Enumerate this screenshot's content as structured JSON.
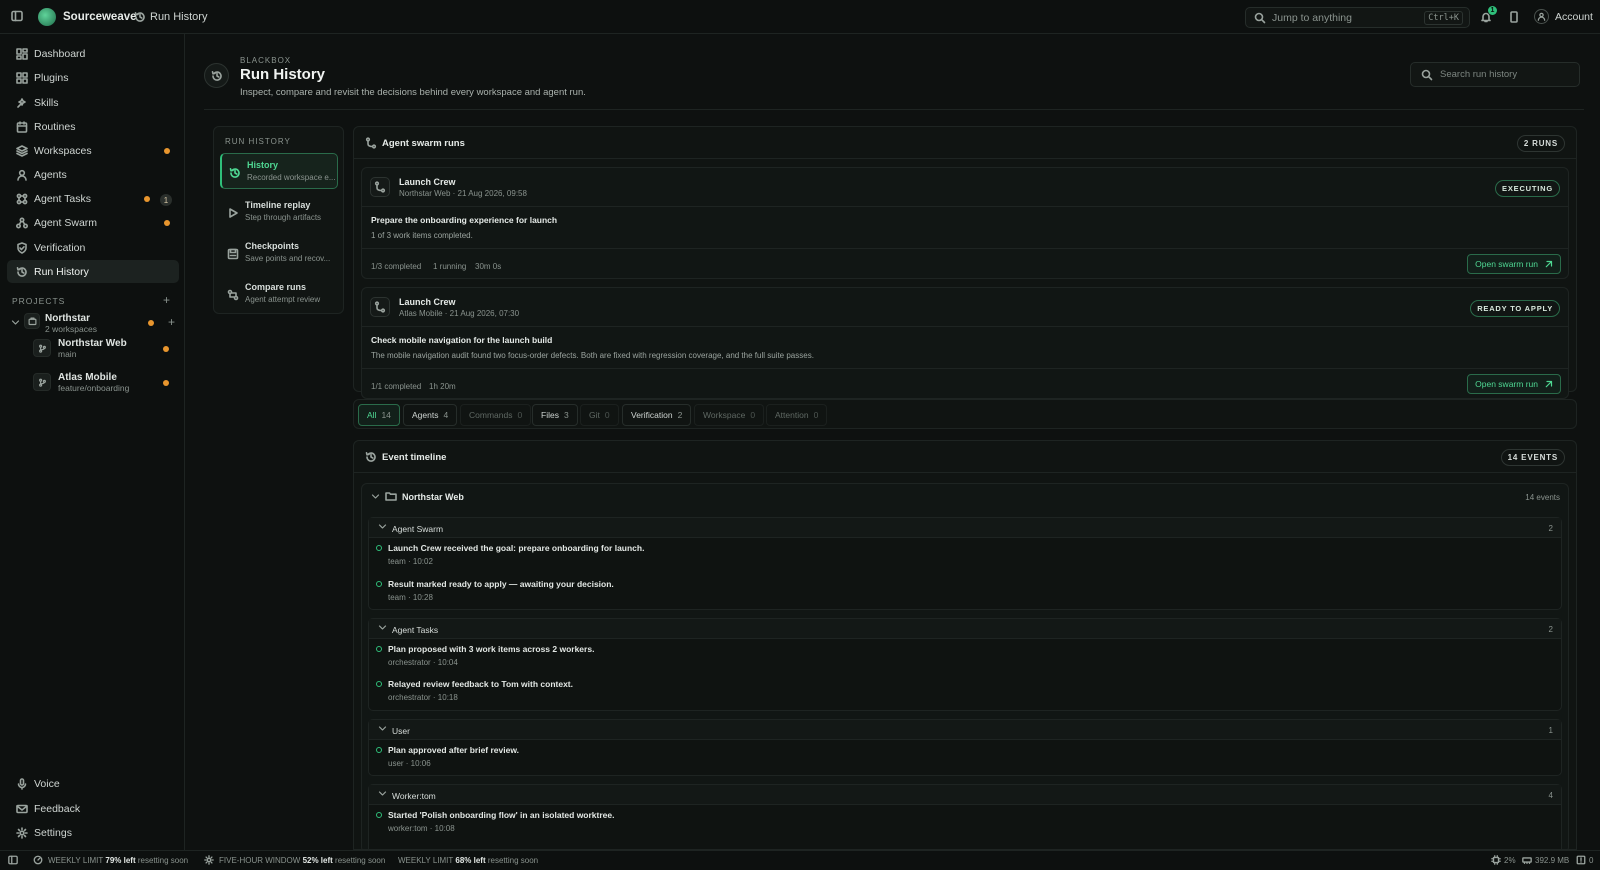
{
  "topbar": {
    "brand": "Sourceweave",
    "breadcrumb": "Run History",
    "jump_placeholder": "Jump to anything",
    "jump_shortcut": "Ctrl+K",
    "notif_count": "1",
    "account_label": "Account"
  },
  "sidebar": {
    "items": [
      {
        "label": "Dashboard",
        "icon": "dashboard-icon"
      },
      {
        "label": "Plugins",
        "icon": "plugin-icon"
      },
      {
        "label": "Skills",
        "icon": "skills-icon"
      },
      {
        "label": "Routines",
        "icon": "calendar-icon"
      },
      {
        "label": "Workspaces",
        "icon": "layers-icon"
      },
      {
        "label": "Agents",
        "icon": "user-icon"
      },
      {
        "label": "Agent Tasks",
        "icon": "tasks-icon",
        "count": "1"
      },
      {
        "label": "Agent Swarm",
        "icon": "swarm-icon"
      },
      {
        "label": "Verification",
        "icon": "shield-icon"
      },
      {
        "label": "Run History",
        "icon": "history-icon",
        "active": true
      }
    ],
    "projects_header": "PROJECTS",
    "project": {
      "name": "Northstar",
      "sub": "2 workspaces"
    },
    "workspaces": [
      {
        "name": "Northstar Web",
        "branch": "main"
      },
      {
        "name": "Atlas Mobile",
        "branch": "feature/onboarding"
      }
    ],
    "footer": [
      "Voice",
      "Feedback",
      "Settings"
    ]
  },
  "header": {
    "eyebrow": "BLACKBOX",
    "title": "Run History",
    "subtitle": "Inspect, compare and revisit the decisions behind every workspace and agent run.",
    "search_placeholder": "Search run history"
  },
  "subnav": {
    "title": "RUN HISTORY",
    "items": [
      {
        "label": "History",
        "sub": "Recorded workspace e..."
      },
      {
        "label": "Timeline replay",
        "sub": "Step through artifacts"
      },
      {
        "label": "Checkpoints",
        "sub": "Save points and recov..."
      },
      {
        "label": "Compare runs",
        "sub": "Agent attempt review"
      }
    ]
  },
  "swarm": {
    "title": "Agent swarm runs",
    "count_label": "2 RUNS",
    "runs": [
      {
        "name": "Launch Crew",
        "meta": "Northstar Web · 21 Aug 2026, 09:58",
        "status": "EXECUTING",
        "goal": "Prepare the onboarding experience for launch",
        "desc": "1 of 3 work items completed.",
        "stats": [
          "1/3 completed",
          "1 running",
          "30m 0s"
        ],
        "action": "Open swarm run"
      },
      {
        "name": "Launch Crew",
        "meta": "Atlas Mobile · 21 Aug 2026, 07:30",
        "status": "READY TO APPLY",
        "goal": "Check mobile navigation for the launch build",
        "desc": "The mobile navigation audit found two focus-order defects. Both are fixed with regression coverage, and the full suite passes.",
        "stats": [
          "1/1 completed",
          "1h 20m"
        ],
        "action": "Open swarm run"
      }
    ]
  },
  "filters": [
    {
      "label": "All",
      "count": "14"
    },
    {
      "label": "Agents",
      "count": "4"
    },
    {
      "label": "Commands",
      "count": "0"
    },
    {
      "label": "Files",
      "count": "3"
    },
    {
      "label": "Git",
      "count": "0"
    },
    {
      "label": "Verification",
      "count": "2"
    },
    {
      "label": "Workspace",
      "count": "0"
    },
    {
      "label": "Attention",
      "count": "0"
    }
  ],
  "timeline": {
    "title": "Event timeline",
    "count_label": "14 EVENTS",
    "workspace": "Northstar Web",
    "workspace_count": "14 events",
    "groups": [
      {
        "name": "Agent Swarm",
        "count": "2",
        "events": [
          {
            "text": "Launch Crew received the goal: prepare onboarding for launch.",
            "meta": "team · 10:02"
          },
          {
            "text": "Result marked ready to apply — awaiting your decision.",
            "meta": "team · 10:28"
          }
        ]
      },
      {
        "name": "Agent Tasks",
        "count": "2",
        "events": [
          {
            "text": "Plan proposed with 3 work items across 2 workers.",
            "meta": "orchestrator · 10:04"
          },
          {
            "text": "Relayed review feedback to Tom with context.",
            "meta": "orchestrator · 10:18"
          }
        ]
      },
      {
        "name": "User",
        "count": "1",
        "events": [
          {
            "text": "Plan approved after brief review.",
            "meta": "user · 10:06"
          }
        ]
      },
      {
        "name": "Worker:tom",
        "count": "4",
        "events": [
          {
            "text": "Started 'Polish onboarding flow' in an isolated worktree.",
            "meta": "worker:tom · 10:08"
          }
        ]
      }
    ]
  },
  "statusbar": {
    "limits": [
      {
        "label": "WEEKLY LIMIT",
        "value": "79% left",
        "note": "resetting soon"
      },
      {
        "label": "FIVE-HOUR WINDOW",
        "value": "52% left",
        "note": "resetting soon"
      },
      {
        "label": "WEEKLY LIMIT",
        "value": "68% left",
        "note": "resetting soon"
      }
    ],
    "cpu": "2%",
    "memory": "392.9 MB",
    "alerts": "0"
  },
  "colors": {
    "accent": "#2fbf7a",
    "warning_dot": "#e8962e",
    "background": "#0e1110"
  }
}
